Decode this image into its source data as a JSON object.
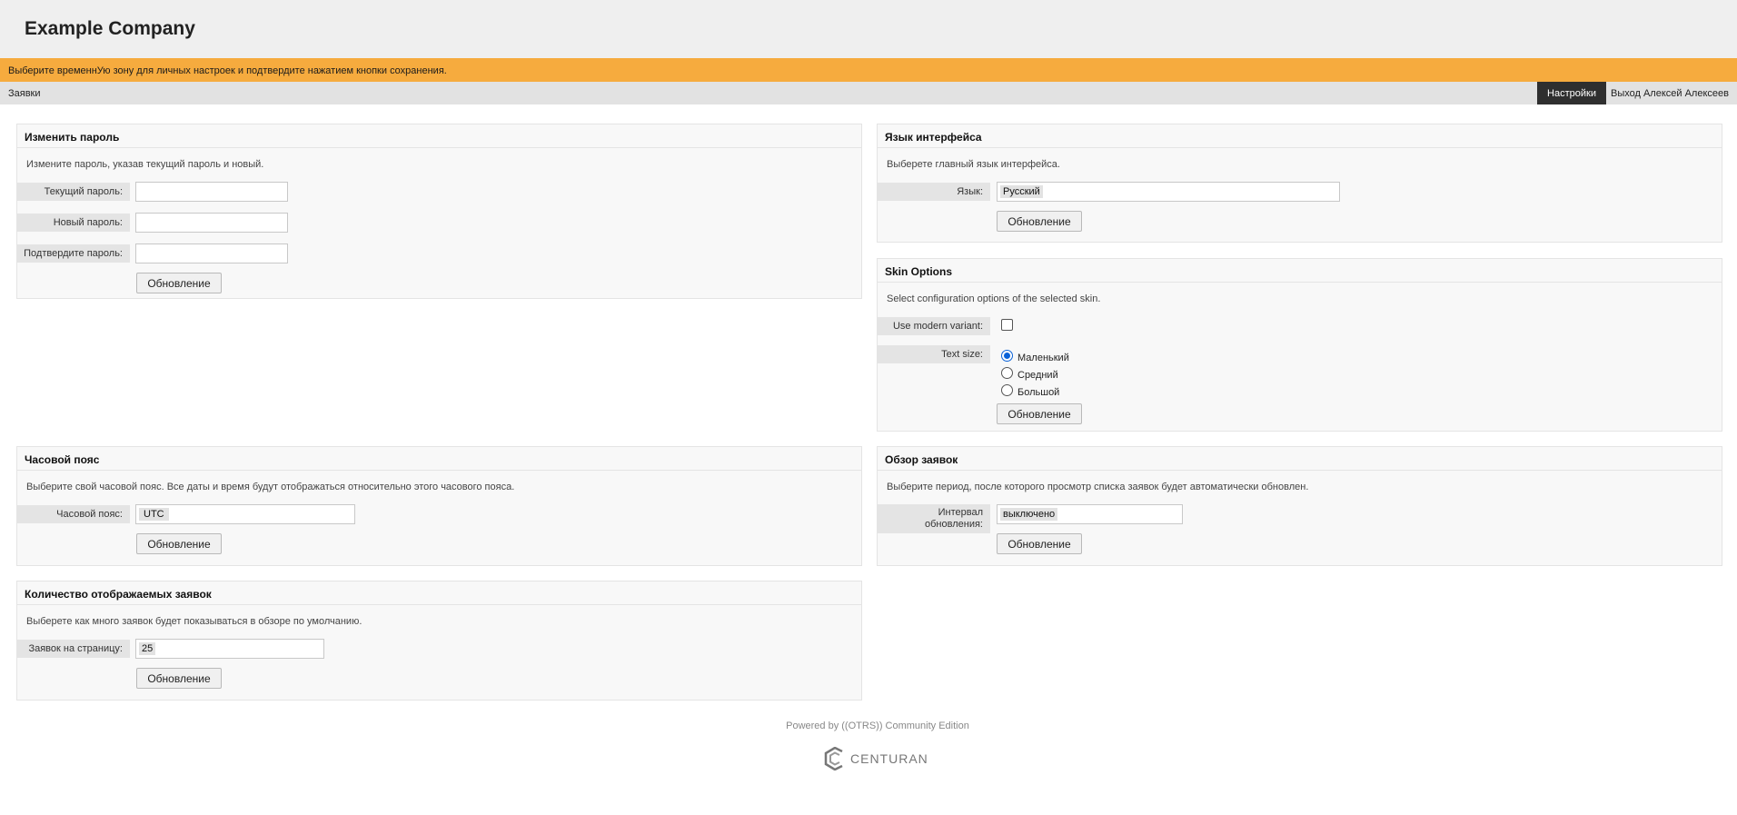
{
  "header": {
    "company": "Example Company"
  },
  "notice": {
    "text": "Выберите временнУю зону для личных настроек и подтвердите нажатием кнопки сохранения."
  },
  "nav": {
    "tickets": "Заявки",
    "preferences": "Настройки",
    "logout": "Выход Алексей Алексеев"
  },
  "change_password": {
    "title": "Изменить пароль",
    "description": "Измените пароль, указав текущий пароль и новый.",
    "current_label": "Текущий пароль:",
    "new_label": "Новый пароль:",
    "confirm_label": "Подтвердите пароль:",
    "submit": "Обновление"
  },
  "language": {
    "title": "Язык интерфейса",
    "description": "Выберете главный язык интерфейса.",
    "label": "Язык:",
    "value": "Русский",
    "submit": "Обновление"
  },
  "skin": {
    "title": "Skin Options",
    "description": "Select configuration options of the selected skin.",
    "modern_label": "Use modern variant:",
    "modern_checked": false,
    "textsize_label": "Text size:",
    "options": [
      "Маленький",
      "Средний",
      "Большой"
    ],
    "selected": "Маленький",
    "submit": "Обновление"
  },
  "timezone": {
    "title": "Часовой пояс",
    "description": "Выберите свой часовой пояс. Все даты и время будут отображаться относительно этого часового пояса.",
    "label": "Часовой пояс:",
    "value": "UTC",
    "submit": "Обновление"
  },
  "ticket_overview": {
    "title": "Обзор заявок",
    "description": "Выберите период, после которого просмотр списка заявок будет автоматически обновлен.",
    "label_line1": "Интервал",
    "label_line2": "обновления:",
    "value": "выключено",
    "submit": "Обновление"
  },
  "ticket_count": {
    "title": "Количество отображаемых заявок",
    "description": "Выберете как много заявок будет показываться в обзоре по умолчанию.",
    "label": "Заявок на страницу:",
    "value": "25",
    "submit": "Обновление"
  },
  "footer": {
    "powered": "Powered by ((OTRS)) Community Edition",
    "brand": "CENTURAN"
  },
  "icons": {
    "brand": "centuran-logo-icon"
  },
  "colors": {
    "notice": "#f6ab3e",
    "active_nav": "#2f2f2f",
    "radio_checked": "#0a62d8"
  }
}
